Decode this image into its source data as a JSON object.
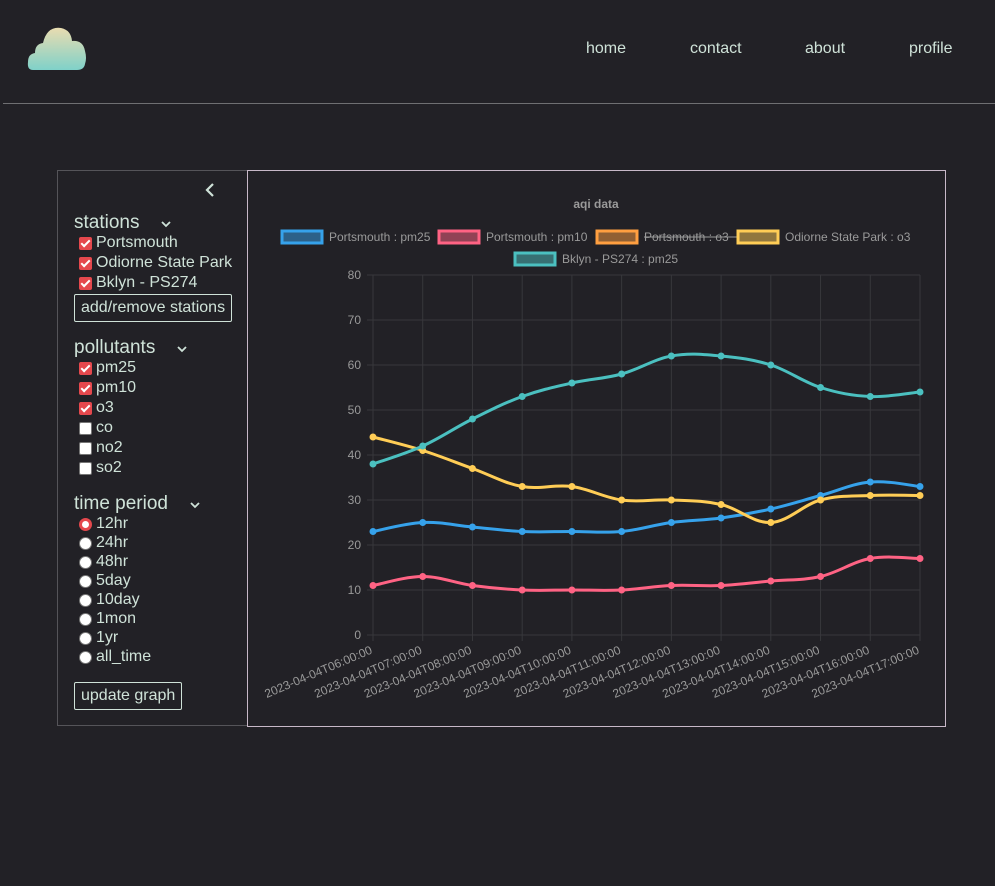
{
  "nav": {
    "links": [
      "home",
      "contact",
      "about",
      "profile"
    ]
  },
  "sidebar": {
    "stations": {
      "title": "stations",
      "items": [
        {
          "label": "Portsmouth",
          "checked": true
        },
        {
          "label": "Odiorne State Park",
          "checked": true
        },
        {
          "label": "Bklyn - PS274",
          "checked": true
        }
      ],
      "button": "add/remove stations"
    },
    "pollutants": {
      "title": "pollutants",
      "items": [
        {
          "label": "pm25",
          "checked": true
        },
        {
          "label": "pm10",
          "checked": true
        },
        {
          "label": "o3",
          "checked": true
        },
        {
          "label": "co",
          "checked": false
        },
        {
          "label": "no2",
          "checked": false
        },
        {
          "label": "so2",
          "checked": false
        }
      ]
    },
    "time_period": {
      "title": "time period",
      "options": [
        "12hr",
        "24hr",
        "48hr",
        "5day",
        "10day",
        "1mon",
        "1yr",
        "all_time"
      ],
      "selected": "12hr"
    },
    "update_button": "update graph"
  },
  "colors": {
    "background": "#222126",
    "text": "#cfe2d8",
    "checked": "#e5484d"
  },
  "chart_data": {
    "type": "line",
    "title": "aqi data",
    "x": [
      "2023-04-04T06:00:00",
      "2023-04-04T07:00:00",
      "2023-04-04T08:00:00",
      "2023-04-04T09:00:00",
      "2023-04-04T10:00:00",
      "2023-04-04T11:00:00",
      "2023-04-04T12:00:00",
      "2023-04-04T13:00:00",
      "2023-04-04T14:00:00",
      "2023-04-04T15:00:00",
      "2023-04-04T16:00:00",
      "2023-04-04T17:00:00"
    ],
    "ylim": [
      0,
      80
    ],
    "yticks": [
      0,
      10,
      20,
      30,
      40,
      50,
      60,
      70,
      80
    ],
    "grid": true,
    "legend_position": "top",
    "series": [
      {
        "name": "Portsmouth : pm25",
        "color": "#36a2eb",
        "hidden": false,
        "values": [
          23,
          25,
          24,
          23,
          23,
          23,
          25,
          26,
          28,
          31,
          34,
          33
        ]
      },
      {
        "name": "Portsmouth : pm10",
        "color": "#ff6384",
        "hidden": false,
        "values": [
          11,
          13,
          11,
          10,
          10,
          10,
          11,
          11,
          12,
          13,
          17,
          17
        ]
      },
      {
        "name": "Portsmouth : o3",
        "color": "#ff9f40",
        "hidden": true,
        "values": []
      },
      {
        "name": "Odiorne State Park : o3",
        "color": "#ffcd56",
        "hidden": false,
        "values": [
          44,
          41,
          37,
          33,
          33,
          30,
          30,
          29,
          25,
          30,
          31,
          31
        ]
      },
      {
        "name": "Bklyn - PS274 : pm25",
        "color": "#4bc0c0",
        "hidden": false,
        "values": [
          38,
          42,
          48,
          53,
          56,
          58,
          62,
          62,
          60,
          55,
          53,
          54
        ]
      }
    ]
  }
}
